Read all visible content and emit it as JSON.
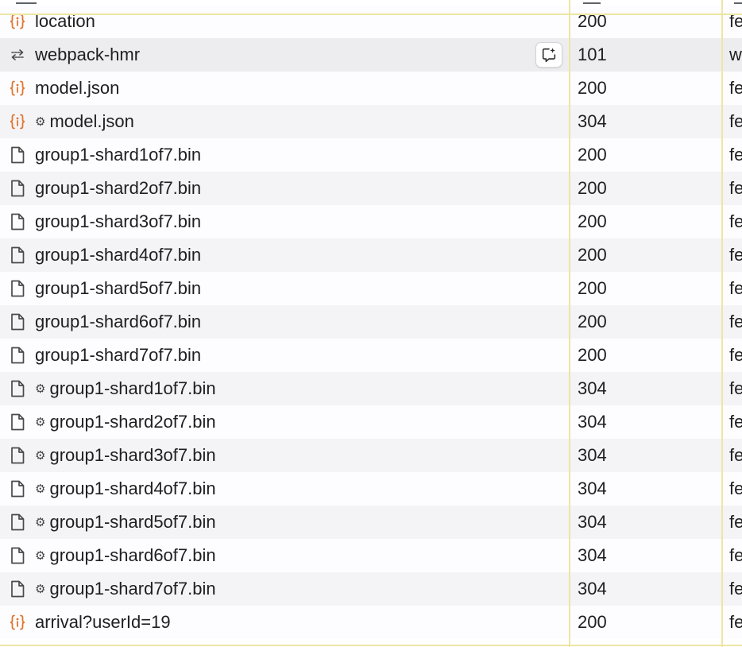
{
  "requests": [
    {
      "name": "location",
      "icon": "json-brace-icon",
      "cached": false,
      "status": "200",
      "type": "fe"
    },
    {
      "name": "webpack-hmr",
      "icon": "websocket-arrows-icon",
      "cached": false,
      "status": "101",
      "type": "w",
      "hovered": true
    },
    {
      "name": "model.json",
      "icon": "json-brace-icon",
      "cached": false,
      "status": "200",
      "type": "fe"
    },
    {
      "name": "model.json",
      "icon": "json-brace-icon",
      "cached": true,
      "status": "304",
      "type": "fe"
    },
    {
      "name": "group1-shard1of7.bin",
      "icon": "document-icon",
      "cached": false,
      "status": "200",
      "type": "fe"
    },
    {
      "name": "group1-shard2of7.bin",
      "icon": "document-icon",
      "cached": false,
      "status": "200",
      "type": "fe"
    },
    {
      "name": "group1-shard3of7.bin",
      "icon": "document-icon",
      "cached": false,
      "status": "200",
      "type": "fe"
    },
    {
      "name": "group1-shard4of7.bin",
      "icon": "document-icon",
      "cached": false,
      "status": "200",
      "type": "fe"
    },
    {
      "name": "group1-shard5of7.bin",
      "icon": "document-icon",
      "cached": false,
      "status": "200",
      "type": "fe"
    },
    {
      "name": "group1-shard6of7.bin",
      "icon": "document-icon",
      "cached": false,
      "status": "200",
      "type": "fe"
    },
    {
      "name": "group1-shard7of7.bin",
      "icon": "document-icon",
      "cached": false,
      "status": "200",
      "type": "fe"
    },
    {
      "name": "group1-shard1of7.bin",
      "icon": "document-icon",
      "cached": true,
      "status": "304",
      "type": "fe"
    },
    {
      "name": "group1-shard2of7.bin",
      "icon": "document-icon",
      "cached": true,
      "status": "304",
      "type": "fe"
    },
    {
      "name": "group1-shard3of7.bin",
      "icon": "document-icon",
      "cached": true,
      "status": "304",
      "type": "fe"
    },
    {
      "name": "group1-shard4of7.bin",
      "icon": "document-icon",
      "cached": true,
      "status": "304",
      "type": "fe"
    },
    {
      "name": "group1-shard5of7.bin",
      "icon": "document-icon",
      "cached": true,
      "status": "304",
      "type": "fe"
    },
    {
      "name": "group1-shard6of7.bin",
      "icon": "document-icon",
      "cached": true,
      "status": "304",
      "type": "fe"
    },
    {
      "name": "group1-shard7of7.bin",
      "icon": "document-icon",
      "cached": true,
      "status": "304",
      "type": "fe"
    },
    {
      "name": "arrival?userId=19",
      "icon": "json-brace-icon",
      "cached": false,
      "status": "200",
      "type": "fe"
    }
  ],
  "cached_marker": "⚙",
  "colors": {
    "json_icon": "#e0752d",
    "doc_icon": "#4a4a4a",
    "ws_icon": "#4a4a4a",
    "column_divider": "#ece6a3",
    "row_odd": "#fdfcff",
    "row_even": "#f4f3f6",
    "row_hover": "#ededf0"
  },
  "hover_action": {
    "icon": "ai-assist-sparkle-icon"
  }
}
